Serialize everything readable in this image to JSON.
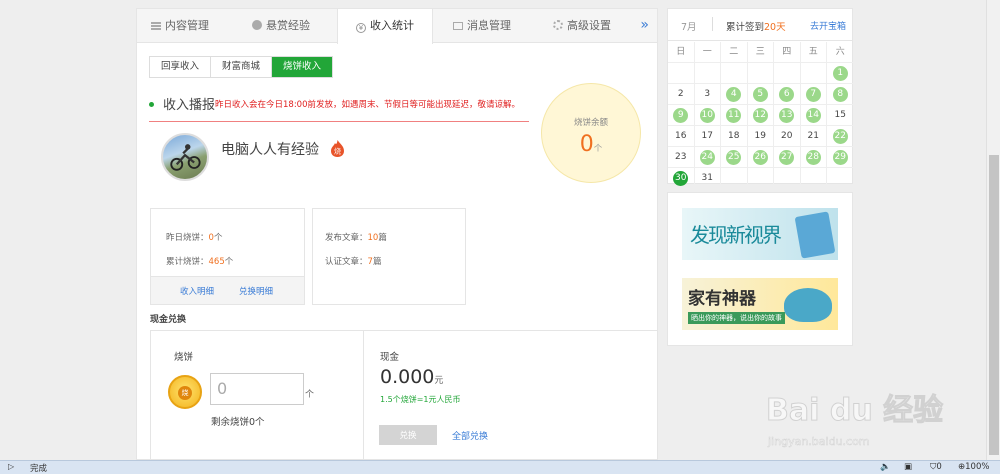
{
  "tabs": [
    {
      "label": "内容管理",
      "icon": "list-icon"
    },
    {
      "label": "悬赏经验",
      "icon": "bounty-icon"
    },
    {
      "label": "收入统计",
      "icon": "yen-icon"
    },
    {
      "label": "消息管理",
      "icon": "mail-icon"
    },
    {
      "label": "高级设置",
      "icon": "gear-icon"
    }
  ],
  "tabs_more": "»",
  "subtabs": [
    "回享收入",
    "财富商城",
    "烧饼收入"
  ],
  "broadcast": {
    "title": "收入播报",
    "note": "昨日收入会在今日18:00前发放，如遇周末、节假日等可能出现延迟，敬请谅解。"
  },
  "balance": {
    "label": "烧饼余额",
    "value": "0",
    "unit": "个"
  },
  "user": {
    "name": "电脑人人有经验",
    "badge": "烧"
  },
  "stats_left": {
    "yesterday_label": "昨日烧饼：",
    "yesterday_value": "0",
    "yesterday_unit": "个",
    "total_label": "累计烧饼：",
    "total_value": "465",
    "total_unit": "个",
    "link_income": "收入明细",
    "link_exchange": "兑换明细"
  },
  "stats_right": {
    "published_label": "发布文章：",
    "published_value": "10",
    "published_unit": "篇",
    "certified_label": "认证文章：",
    "certified_value": "7",
    "certified_unit": "篇"
  },
  "cash_exchange": {
    "section_title": "现金兑换",
    "shaobing_label": "烧饼",
    "coin_text": "烧",
    "input_placeholder": "0",
    "unit": "个",
    "remain": "剩余烧饼0个",
    "cash_label": "现金",
    "cash_value": "0.000",
    "cash_unit": "元",
    "rate": "1.5个烧饼=1元人民币",
    "exchange_button": "兑换",
    "exchange_all": "全部兑换"
  },
  "calendar": {
    "month": "7月",
    "sign_label": "累计签到",
    "sign_days": "20天",
    "open_box": "去开宝箱",
    "weekdays": [
      "日",
      "一",
      "二",
      "三",
      "四",
      "五",
      "六"
    ],
    "weeks": [
      [
        {
          "d": ""
        },
        {
          "d": ""
        },
        {
          "d": ""
        },
        {
          "d": ""
        },
        {
          "d": ""
        },
        {
          "d": ""
        },
        {
          "d": "1",
          "s": 1
        }
      ],
      [
        {
          "d": "2"
        },
        {
          "d": "3"
        },
        {
          "d": "4",
          "s": 1
        },
        {
          "d": "5",
          "s": 1
        },
        {
          "d": "6",
          "s": 1
        },
        {
          "d": "7",
          "s": 1
        },
        {
          "d": "8",
          "s": 1
        }
      ],
      [
        {
          "d": "9",
          "s": 1
        },
        {
          "d": "10",
          "s": 1
        },
        {
          "d": "11",
          "s": 1
        },
        {
          "d": "12",
          "s": 1
        },
        {
          "d": "13",
          "s": 1
        },
        {
          "d": "14",
          "s": 1
        },
        {
          "d": "15"
        }
      ],
      [
        {
          "d": "16"
        },
        {
          "d": "17"
        },
        {
          "d": "18"
        },
        {
          "d": "19"
        },
        {
          "d": "20"
        },
        {
          "d": "21"
        },
        {
          "d": "22",
          "s": 1
        }
      ],
      [
        {
          "d": "23"
        },
        {
          "d": "24",
          "s": 1
        },
        {
          "d": "25",
          "s": 1
        },
        {
          "d": "26",
          "s": 1
        },
        {
          "d": "27",
          "s": 1
        },
        {
          "d": "28",
          "s": 1
        },
        {
          "d": "29",
          "s": 1
        }
      ],
      [
        {
          "d": "30",
          "t": 1
        },
        {
          "d": "31"
        },
        {
          "d": ""
        },
        {
          "d": ""
        },
        {
          "d": ""
        },
        {
          "d": ""
        },
        {
          "d": ""
        }
      ]
    ]
  },
  "ads": {
    "ad1_text": "发现新视界",
    "ad2_text": "家有神器",
    "ad2_sub": "晒出你的神器，说出你的故事"
  },
  "statusbar": {
    "status": "完成",
    "shield_count": "0",
    "zoom": "100%"
  },
  "watermark": {
    "logo": "Bai du 经验",
    "url": "jingyan.baidu.com"
  }
}
